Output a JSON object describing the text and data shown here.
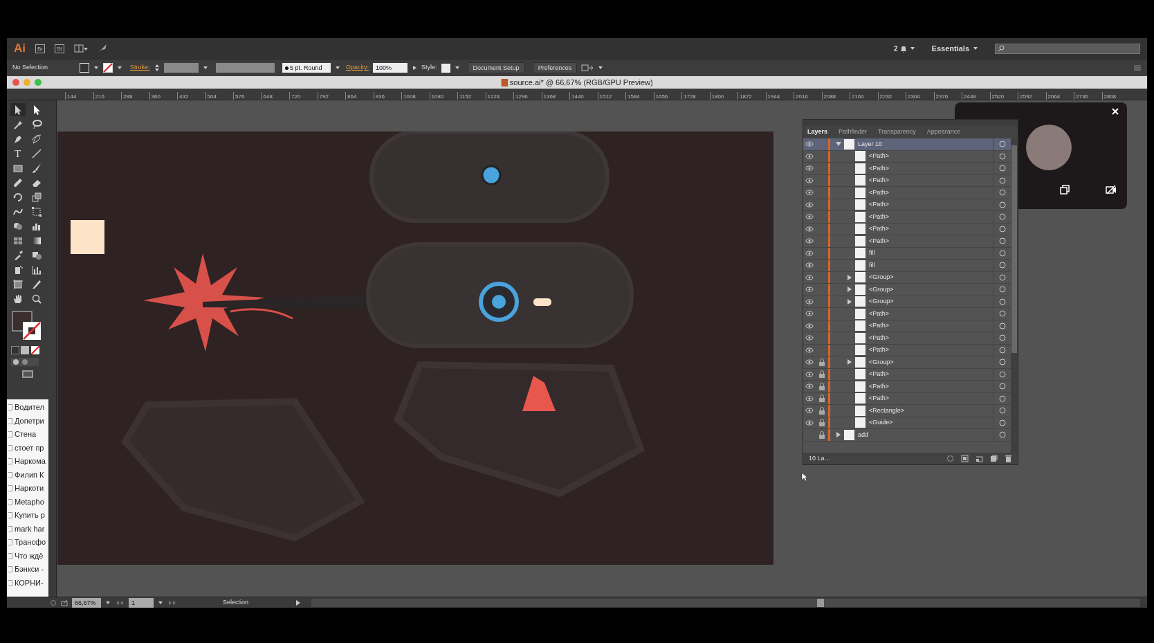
{
  "app_bar": {
    "logo": "Ai",
    "bridge": "Br",
    "stock": "St",
    "notifications": "2",
    "workspace": "Essentials"
  },
  "control_bar": {
    "selection": "No Selection",
    "stroke_label": "Stroke:",
    "brush": "5 pt. Round",
    "opacity_label": "Opacity:",
    "opacity": "100%",
    "style_label": "Style:",
    "buttons": [
      "Document Setup",
      "Preferences"
    ]
  },
  "document": {
    "title": "source.ai* @ 66,67% (RGB/GPU Preview)"
  },
  "ruler": [
    "144",
    "216",
    "288",
    "360",
    "432",
    "504",
    "576",
    "648",
    "720",
    "792",
    "864",
    "936",
    "1008",
    "1080",
    "1152",
    "1224",
    "1296",
    "1368",
    "1440",
    "1512",
    "1584",
    "1656",
    "1728",
    "1800",
    "1872",
    "1944",
    "2016",
    "2088",
    "2160",
    "2232",
    "2304",
    "2376",
    "2448",
    "2520",
    "2592",
    "2664",
    "2736",
    "2808"
  ],
  "toolbox": {
    "type_tool": "T"
  },
  "bookmarks": [
    "Водител",
    "Допетри",
    "Стена",
    "стоет пр",
    "Наркома",
    "Филип К",
    "Наркоти",
    "Metapho",
    "Купить р",
    "mark har",
    "Трансфо",
    "Что ждё",
    "Бэнкси -",
    "КОРНИ-"
  ],
  "layers_panel": {
    "tabs": [
      {
        "label": "Layers",
        "selected": true
      },
      {
        "label": "Pathfinder",
        "selected": false
      },
      {
        "label": "Transparency",
        "selected": false
      },
      {
        "label": "Appearance",
        "selected": false
      }
    ],
    "layers": [
      {
        "name": "Layer 10",
        "kind": "layer",
        "expanded": true,
        "selected": true,
        "visible": true,
        "locked": false,
        "children": [
          {
            "name": "<Path>",
            "kind": "path",
            "selected": false,
            "visible": true,
            "locked": false
          },
          {
            "name": "<Path>",
            "kind": "path",
            "selected": false,
            "visible": true,
            "locked": false
          },
          {
            "name": "<Path>",
            "kind": "path",
            "selected": false,
            "visible": true,
            "locked": false
          },
          {
            "name": "<Path>",
            "kind": "path",
            "selected": false,
            "visible": true,
            "locked": false
          },
          {
            "name": "<Path>",
            "kind": "path",
            "selected": false,
            "visible": true,
            "locked": false
          },
          {
            "name": "<Path>",
            "kind": "path",
            "selected": false,
            "visible": true,
            "locked": false
          },
          {
            "name": "<Path>",
            "kind": "path",
            "selected": false,
            "visible": true,
            "locked": false
          },
          {
            "name": "<Path>",
            "kind": "path",
            "selected": false,
            "visible": true,
            "locked": false
          },
          {
            "name": "fill",
            "kind": "path",
            "selected": false,
            "visible": true,
            "locked": false
          },
          {
            "name": "fill",
            "kind": "path",
            "selected": false,
            "visible": true,
            "locked": false
          },
          {
            "name": "<Group>",
            "kind": "group",
            "expanded": false,
            "selected": false,
            "visible": true,
            "locked": false
          },
          {
            "name": "<Group>",
            "kind": "group",
            "expanded": false,
            "selected": false,
            "visible": true,
            "locked": false
          },
          {
            "name": "<Group>",
            "kind": "group",
            "expanded": false,
            "selected": false,
            "visible": true,
            "locked": false
          },
          {
            "name": "<Path>",
            "kind": "path",
            "selected": false,
            "visible": true,
            "locked": false
          },
          {
            "name": "<Path>",
            "kind": "path",
            "selected": false,
            "visible": true,
            "locked": false
          },
          {
            "name": "<Path>",
            "kind": "path",
            "selected": false,
            "visible": true,
            "locked": false
          },
          {
            "name": "<Path>",
            "kind": "path",
            "selected": false,
            "visible": true,
            "locked": false
          },
          {
            "name": "<Group>",
            "kind": "group",
            "expanded": false,
            "selected": false,
            "visible": true,
            "locked": true
          },
          {
            "name": "<Path>",
            "kind": "path",
            "selected": false,
            "visible": true,
            "locked": true
          },
          {
            "name": "<Path>",
            "kind": "path",
            "selected": false,
            "visible": true,
            "locked": true
          },
          {
            "name": "<Path>",
            "kind": "path",
            "selected": false,
            "visible": true,
            "locked": true
          },
          {
            "name": "<Rectangle>",
            "kind": "path",
            "selected": false,
            "visible": true,
            "locked": true
          },
          {
            "name": "<Guide>",
            "kind": "path",
            "selected": false,
            "visible": true,
            "locked": true
          }
        ]
      },
      {
        "name": "add",
        "kind": "layer",
        "expanded": false,
        "selected": false,
        "visible": false,
        "locked": true
      }
    ],
    "footer": "10 La…"
  },
  "status_bar": {
    "zoom": "66,67%",
    "artboard": "1",
    "tool": "Selection"
  }
}
